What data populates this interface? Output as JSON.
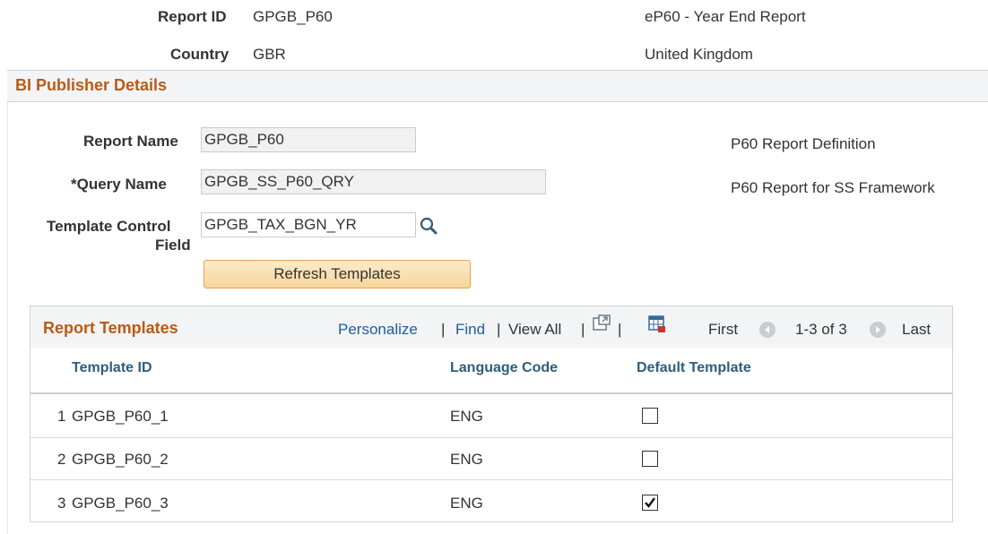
{
  "header": {
    "report_id_label": "Report ID",
    "report_id_value": "GPGB_P60",
    "report_id_desc": "eP60 - Year End Report",
    "country_label": "Country",
    "country_value": "GBR",
    "country_desc": "United Kingdom"
  },
  "bi_section": {
    "title": "BI Publisher Details",
    "report_name_label": "Report Name",
    "report_name_value": "GPGB_P60",
    "report_name_desc": "P60 Report Definition",
    "query_name_label": "*Query Name",
    "query_name_value": "GPGB_SS_P60_QRY",
    "query_name_desc": "P60 Report for SS Framework",
    "template_control_label_line1": "Template Control",
    "template_control_label_line2": "Field",
    "template_control_value": "GPGB_TAX_BGN_YR",
    "refresh_button": "Refresh Templates"
  },
  "grid": {
    "title": "Report Templates",
    "personalize": "Personalize",
    "sep1": "|",
    "find": "Find",
    "sep2": "|",
    "view_all": "View All",
    "sep3": "|",
    "sep4": "|",
    "first": "First",
    "range": "1-3 of 3",
    "last": "Last",
    "columns": [
      "Template ID",
      "Language Code",
      "Default Template"
    ],
    "rows": [
      {
        "num": "1",
        "template_id": "GPGB_P60_1",
        "language": "ENG",
        "default": false
      },
      {
        "num": "2",
        "template_id": "GPGB_P60_2",
        "language": "ENG",
        "default": false
      },
      {
        "num": "3",
        "template_id": "GPGB_P60_3",
        "language": "ENG",
        "default": true
      }
    ]
  },
  "colors": {
    "section_title": "#bb5a14",
    "link": "#1c5c9e",
    "column_header": "#2f5d7c",
    "button_border": "#e6a25a"
  },
  "icons": {
    "lookup": "magnifier-icon",
    "new_window": "new-window-icon",
    "download": "spreadsheet-download-icon",
    "prev": "previous-arrow-icon",
    "next": "next-arrow-icon"
  }
}
